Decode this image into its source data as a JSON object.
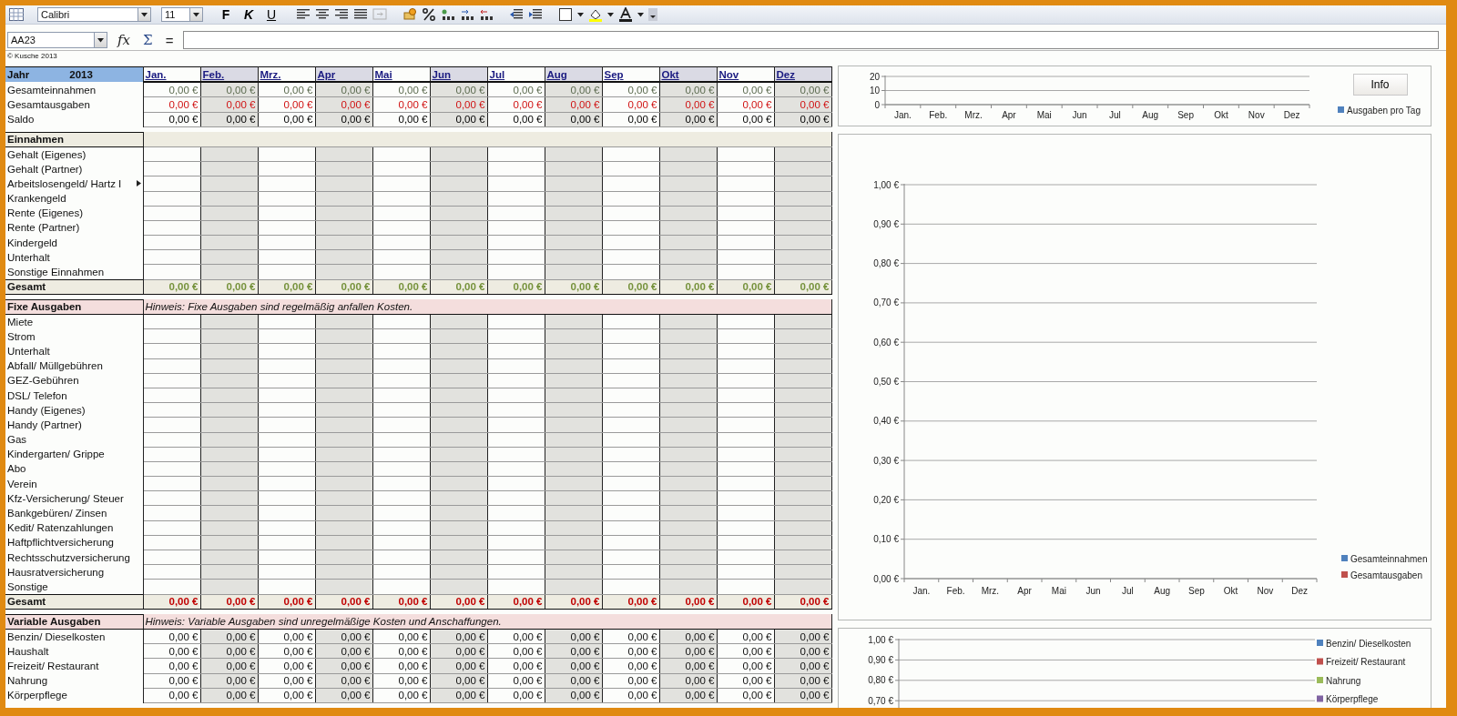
{
  "toolbar": {
    "font": "Calibri",
    "font_size": "11",
    "style_buttons": [
      "F",
      "K",
      "U"
    ]
  },
  "formula_bar": {
    "name_box": "AA23",
    "buttons": [
      "fx",
      "Σ",
      "="
    ]
  },
  "copyright": "© Kusche 2013",
  "sheet": {
    "year_label": "Jahr",
    "year": "2013",
    "months": [
      "Jan.",
      "Feb.",
      "Mrz.",
      "Apr",
      "Mai",
      "Jun",
      "Jul",
      "Aug",
      "Sep",
      "Okt",
      "Nov",
      "Dez"
    ],
    "summary": [
      {
        "label": "Gesamteinnahmen",
        "kind": "income",
        "values": [
          "0,00 €",
          "0,00 €",
          "0,00 €",
          "0,00 €",
          "0,00 €",
          "0,00 €",
          "0,00 €",
          "0,00 €",
          "0,00 €",
          "0,00 €",
          "0,00 €",
          "0,00 €"
        ]
      },
      {
        "label": "Gesamtausgaben",
        "kind": "expense",
        "values": [
          "0,00 €",
          "0,00 €",
          "0,00 €",
          "0,00 €",
          "0,00 €",
          "0,00 €",
          "0,00 €",
          "0,00 €",
          "0,00 €",
          "0,00 €",
          "0,00 €",
          "0,00 €"
        ]
      },
      {
        "label": "Saldo",
        "kind": "balance",
        "values": [
          "0,00 €",
          "0,00 €",
          "0,00 €",
          "0,00 €",
          "0,00 €",
          "0,00 €",
          "0,00 €",
          "0,00 €",
          "0,00 €",
          "0,00 €",
          "0,00 €",
          "0,00 €"
        ]
      }
    ],
    "sections": [
      {
        "title": "Einnahmen",
        "kind": "income",
        "rows": [
          {
            "label": "Gehalt (Eigenes)",
            "truncated": false
          },
          {
            "label": "Gehalt  (Partner)",
            "truncated": false
          },
          {
            "label": "Arbeitslosengeld/ Hartz I",
            "truncated": true
          },
          {
            "label": "Krankengeld",
            "truncated": false
          },
          {
            "label": "Rente (Eigenes)",
            "truncated": false
          },
          {
            "label": "Rente (Partner)",
            "truncated": false
          },
          {
            "label": "Kindergeld",
            "truncated": false
          },
          {
            "label": "Unterhalt",
            "truncated": false
          },
          {
            "label": "Sonstige Einnahmen",
            "truncated": false
          }
        ],
        "total": {
          "label": "Gesamt",
          "values": [
            "0,00 €",
            "0,00 €",
            "0,00 €",
            "0,00 €",
            "0,00 €",
            "0,00 €",
            "0,00 €",
            "0,00 €",
            "0,00 €",
            "0,00 €",
            "0,00 €",
            "0,00 €"
          ]
        }
      },
      {
        "title": "Fixe Ausgaben",
        "kind": "fixed",
        "note": "Hinweis: Fixe Ausgaben sind regelmäßig anfallen Kosten.",
        "rows": [
          {
            "label": "Miete"
          },
          {
            "label": "Strom"
          },
          {
            "label": "Unterhalt"
          },
          {
            "label": "Abfall/ Müllgebühren"
          },
          {
            "label": "GEZ-Gebühren"
          },
          {
            "label": "DSL/ Telefon"
          },
          {
            "label": "Handy (Eigenes)"
          },
          {
            "label": "Handy (Partner)"
          },
          {
            "label": "Gas"
          },
          {
            "label": "Kindergarten/ Grippe"
          },
          {
            "label": "Abo"
          },
          {
            "label": "Verein"
          },
          {
            "label": "Kfz-Versicherung/ Steuer"
          },
          {
            "label": "Bankgebüren/ Zinsen"
          },
          {
            "label": "Kedit/ Ratenzahlungen"
          },
          {
            "label": "Haftpflichtversicherung"
          },
          {
            "label": "Rechtsschutzversicherung"
          },
          {
            "label": "Hausratversicherung"
          },
          {
            "label": "Sonstige"
          }
        ],
        "total": {
          "label": "Gesamt",
          "values": [
            "0,00 €",
            "0,00 €",
            "0,00 €",
            "0,00 €",
            "0,00 €",
            "0,00 €",
            "0,00 €",
            "0,00 €",
            "0,00 €",
            "0,00 €",
            "0,00 €",
            "0,00 €"
          ]
        }
      },
      {
        "title": "Variable Ausgaben",
        "kind": "variable",
        "note": "Hinweis: Variable Ausgaben sind unregelmäßige Kosten und Anschaffungen.",
        "rows": [
          {
            "label": "Benzin/ Dieselkosten",
            "values": [
              "0,00 €",
              "0,00 €",
              "0,00 €",
              "0,00 €",
              "0,00 €",
              "0,00 €",
              "0,00 €",
              "0,00 €",
              "0,00 €",
              "0,00 €",
              "0,00 €",
              "0,00 €"
            ]
          },
          {
            "label": "Haushalt",
            "values": [
              "0,00 €",
              "0,00 €",
              "0,00 €",
              "0,00 €",
              "0,00 €",
              "0,00 €",
              "0,00 €",
              "0,00 €",
              "0,00 €",
              "0,00 €",
              "0,00 €",
              "0,00 €"
            ]
          },
          {
            "label": "Freizeit/ Restaurant",
            "values": [
              "0,00 €",
              "0,00 €",
              "0,00 €",
              "0,00 €",
              "0,00 €",
              "0,00 €",
              "0,00 €",
              "0,00 €",
              "0,00 €",
              "0,00 €",
              "0,00 €",
              "0,00 €"
            ]
          },
          {
            "label": "Nahrung",
            "values": [
              "0,00 €",
              "0,00 €",
              "0,00 €",
              "0,00 €",
              "0,00 €",
              "0,00 €",
              "0,00 €",
              "0,00 €",
              "0,00 €",
              "0,00 €",
              "0,00 €",
              "0,00 €"
            ]
          },
          {
            "label": "Körperpflege",
            "values": [
              "0,00 €",
              "0,00 €",
              "0,00 €",
              "0,00 €",
              "0,00 €",
              "0,00 €",
              "0,00 €",
              "0,00 €",
              "0,00 €",
              "0,00 €",
              "0,00 €",
              "0,00 €"
            ]
          }
        ]
      }
    ]
  },
  "charts": [
    {
      "info_button": "Info",
      "chart_data": {
        "type": "bar",
        "grid": true,
        "categories": [
          "Jan.",
          "Feb.",
          "Mrz.",
          "Apr",
          "Mai",
          "Jun",
          "Jul",
          "Aug",
          "Sep",
          "Okt",
          "Nov",
          "Dez"
        ],
        "ylim": [
          0,
          20
        ],
        "yticks": [
          0,
          10,
          20
        ],
        "series": [
          {
            "name": "Ausgaben pro Tag",
            "color": "#4f81bd",
            "values": [
              0,
              0,
              0,
              0,
              0,
              0,
              0,
              0,
              0,
              0,
              0,
              0
            ]
          }
        ]
      }
    },
    {
      "chart_data": {
        "type": "bar",
        "grid": true,
        "categories": [
          "Jan.",
          "Feb.",
          "Mrz.",
          "Apr",
          "Mai",
          "Jun",
          "Jul",
          "Aug",
          "Sep",
          "Okt",
          "Nov",
          "Dez"
        ],
        "ylim": [
          0,
          1
        ],
        "yticks": [
          {
            "value": 0,
            "label": "0,00 €"
          },
          {
            "value": 0.1,
            "label": "0,10 €"
          },
          {
            "value": 0.2,
            "label": "0,20 €"
          },
          {
            "value": 0.3,
            "label": "0,30 €"
          },
          {
            "value": 0.4,
            "label": "0,40 €"
          },
          {
            "value": 0.5,
            "label": "0,50 €"
          },
          {
            "value": 0.6,
            "label": "0,60 €"
          },
          {
            "value": 0.7,
            "label": "0,70 €"
          },
          {
            "value": 0.8,
            "label": "0,80 €"
          },
          {
            "value": 0.9,
            "label": "0,90 €"
          },
          {
            "value": 1,
            "label": "1,00 €"
          }
        ],
        "series": [
          {
            "name": "Gesamteinnahmen",
            "color": "#4f81bd",
            "values": [
              0,
              0,
              0,
              0,
              0,
              0,
              0,
              0,
              0,
              0,
              0,
              0
            ]
          },
          {
            "name": "Gesamtausgaben",
            "color": "#c0504d",
            "values": [
              0,
              0,
              0,
              0,
              0,
              0,
              0,
              0,
              0,
              0,
              0,
              0
            ]
          }
        ]
      }
    },
    {
      "chart_data": {
        "type": "bar",
        "grid": true,
        "ylim": [
          0,
          1
        ],
        "yticks": [
          {
            "value": 1,
            "label": "1,00 €"
          },
          {
            "value": 0.9,
            "label": "0,90 €"
          },
          {
            "value": 0.8,
            "label": "0,80 €"
          },
          {
            "value": 0.7,
            "label": "0,70 €"
          }
        ],
        "series": [
          {
            "name": "Benzin/ Dieselkosten",
            "color": "#4f81bd"
          },
          {
            "name": "Freizeit/ Restaurant",
            "color": "#c0504d"
          },
          {
            "name": "Nahrung",
            "color": "#9bbb59"
          },
          {
            "name": "Körperpflege",
            "color": "#8064a2"
          }
        ]
      }
    }
  ]
}
